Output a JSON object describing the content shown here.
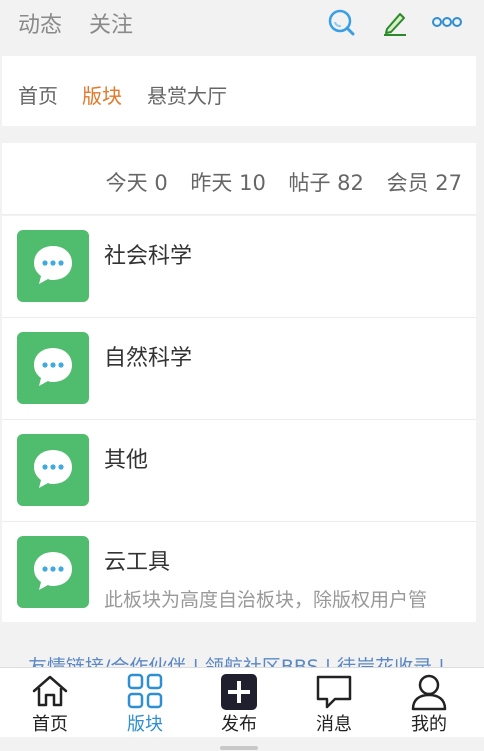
{
  "topbar": {
    "tabs": [
      "动态",
      "关注"
    ],
    "icons": [
      "search-icon",
      "edit-pencil-icon",
      "more-dots-icon"
    ]
  },
  "subnav": {
    "items": [
      "首页",
      "版块",
      "悬赏大厅"
    ],
    "active": "版块"
  },
  "stats": {
    "today": "今天 0",
    "yesterday": "昨天 10",
    "posts": "帖子 82",
    "members": "会员 27"
  },
  "forums": [
    {
      "name": "社会科学",
      "desc": ""
    },
    {
      "name": "自然科学",
      "desc": ""
    },
    {
      "name": "其他",
      "desc": ""
    },
    {
      "name": "云工具",
      "desc": "此板块为高度自治板块，除版权用户管"
    }
  ],
  "footer": {
    "links_text": "友情链接/合作伙伴 | 领航社区BBS | 徒岸花收录 |"
  },
  "bottomnav": {
    "items": [
      "首页",
      "版块",
      "发布",
      "消息",
      "我的"
    ],
    "active": "版块"
  },
  "colors": {
    "accent_orange": "#e07a2c",
    "accent_blue": "#2e8fd3",
    "forum_badge_green": "#4fbc6e",
    "link_blue": "#5a88c4"
  }
}
